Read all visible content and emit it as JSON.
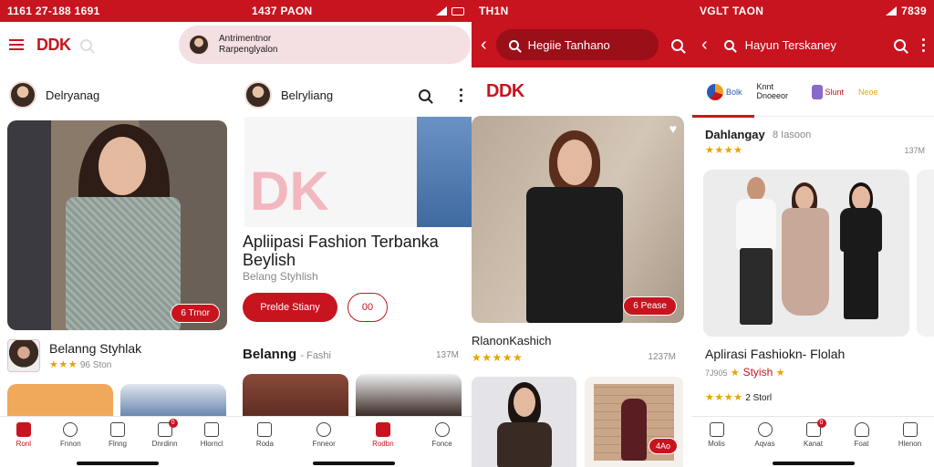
{
  "panel1": {
    "status_time": "1161 27-188 1691",
    "logo": "DDK",
    "promo_text": "Antrimentnor Rarpenglyalon",
    "user_name": "Delryanag",
    "hero_badge": "6 Trnor",
    "product_title": "Belanng Styhlak",
    "product_meta": "96 Ston",
    "nav": [
      "Ronl",
      "Fnnon",
      "Flnng",
      "Dnrdinn",
      "Hlorncl"
    ],
    "nav_badge": "0"
  },
  "panel2": {
    "status_time": "1437 PAON",
    "user_name": "Belryliang",
    "banner_logo": "DK",
    "headline": "Apliipasi Fashion Terbanka Beylish",
    "subline": "Belang Styhlish",
    "primary_button": "Prelde Stiany",
    "secondary_button": "00",
    "section_title": "Belanng",
    "section_subtitle": "Fashi",
    "section_count": "137M",
    "nav": [
      "Roda",
      "Fnneor",
      "Rodbn",
      "Fonce"
    ]
  },
  "panel3": {
    "status_time": "TH1N",
    "search_text": "Hegiie Tanhano",
    "logo": "DDK",
    "hero_badge": "6 Pease",
    "product_title": "RlanonKashich",
    "product_count": "1237M",
    "tile_badge": "4Ao"
  },
  "panel4": {
    "status_time": "VGLT TAON",
    "status_clock": "7839",
    "search_text": "Hayun Terskaney",
    "categories": [
      "Bolk",
      "Knnt Dnoeeor",
      "Slunt",
      "Neoe"
    ],
    "shop_name": "Dahlangay",
    "shop_meta": "8 Iasoon",
    "shop_count": "137M",
    "product_title": "Aplirasi Fashiokn- Flolah",
    "product_sub_prefix": "7J905",
    "product_sub": "Styish",
    "rating_text": "2 Storl",
    "nav": [
      "Molis",
      "Aqvas",
      "Kanat",
      "Foat",
      "Hlenon"
    ],
    "nav_badge": "0"
  },
  "colors": {
    "accent": "#c8141f",
    "star": "#e6a500"
  }
}
